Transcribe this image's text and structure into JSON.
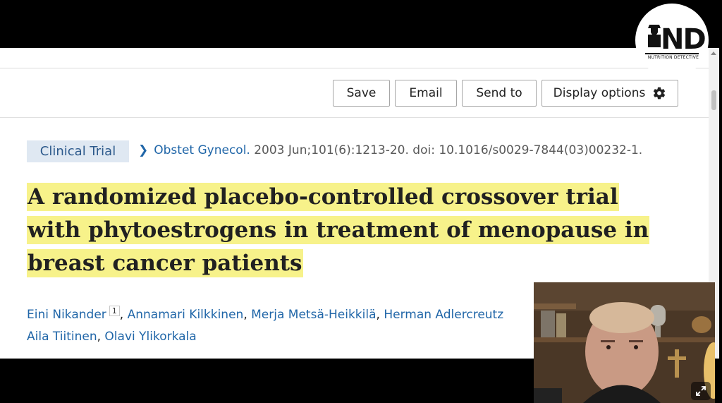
{
  "toolbar": {
    "save": "Save",
    "email": "Email",
    "send_to": "Send to",
    "display_options": "Display options"
  },
  "article": {
    "type_badge": "Clinical Trial",
    "journal": "Obstet Gynecol.",
    "citation": "2003 Jun;101(6):1213-20. doi: 10.1016/s0029-7844(03)00232-1.",
    "title_lines": [
      "A randomized placebo-controlled crossover trial",
      "with phytoestrogens in treatment of menopause in",
      "breast cancer patients"
    ],
    "authors": [
      {
        "name": "Eini Nikander",
        "affil": "1"
      },
      {
        "name": "Annamari Kilkkinen"
      },
      {
        "name": "Merja Metsä-Heikkilä"
      },
      {
        "name": "Herman Adlercreutz"
      },
      {
        "name": "Aila Tiitinen"
      },
      {
        "name": "Olavi Ylikorkala"
      }
    ]
  },
  "logo": {
    "letters": "ND",
    "caption": "NUTRITION DETECTIVE"
  },
  "colors": {
    "link": "#2066a8",
    "highlight": "#f7f28a",
    "badge_bg": "#dfe8f2"
  }
}
